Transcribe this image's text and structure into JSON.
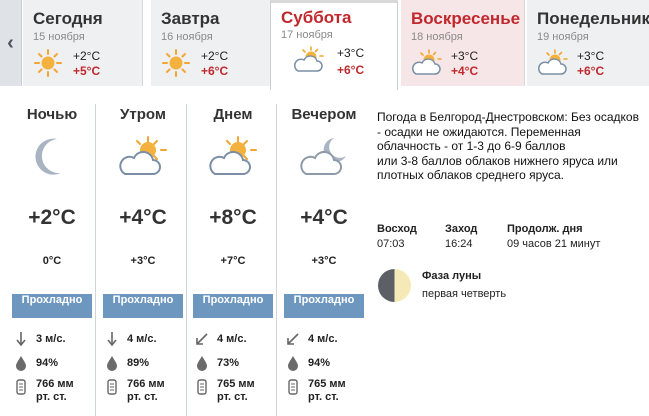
{
  "tabs": [
    {
      "name": "Сегодня",
      "date": "15 ноября",
      "night": "+2°C",
      "day": "+5°C",
      "icon": "sun-icon"
    },
    {
      "name": "Завтра",
      "date": "16 ноября",
      "night": "+2°C",
      "day": "+6°C",
      "icon": "sun-icon"
    },
    {
      "name": "Суббота",
      "date": "17 ноября",
      "night": "+3°C",
      "day": "+6°C",
      "icon": "partly-cloudy-icon"
    },
    {
      "name": "Воскресенье",
      "date": "18 ноября",
      "night": "+3°C",
      "day": "+4°C",
      "icon": "partly-cloudy-icon"
    },
    {
      "name": "Понедельник",
      "date": "19 ноября",
      "night": "+3°C",
      "day": "+6°C",
      "icon": "partly-cloudy-icon"
    }
  ],
  "nav": {
    "prev": "‹"
  },
  "parts": [
    {
      "label": "Ночью",
      "icon": "moon-icon",
      "temp": "+2°C",
      "feels": "0°C",
      "badge": "Прохладно",
      "wind": "3 м/с.",
      "humidity": "94%",
      "pressure_value": "766 мм",
      "pressure_unit": "рт. ст."
    },
    {
      "label": "Утром",
      "icon": "partly-cloudy-icon",
      "temp": "+4°C",
      "feels": "+3°C",
      "badge": "Прохладно",
      "wind": "4 м/с.",
      "humidity": "89%",
      "pressure_value": "766 мм",
      "pressure_unit": "рт. ст."
    },
    {
      "label": "Днем",
      "icon": "partly-cloudy-icon",
      "temp": "+8°C",
      "feels": "+7°C",
      "badge": "Прохладно",
      "wind": "4 м/с.",
      "humidity": "73%",
      "pressure_value": "765 мм",
      "pressure_unit": "рт. ст."
    },
    {
      "label": "Вечером",
      "icon": "cloudy-moon-icon",
      "temp": "+4°C",
      "feels": "+3°C",
      "badge": "Прохладно",
      "wind": "4 м/с.",
      "humidity": "94%",
      "pressure_value": "765 мм",
      "pressure_unit": "рт. ст."
    }
  ],
  "description": "Погода в Белгород-Днестровском: Без осадков - осадки не ожидаются. Переменная облачность - от 1-3 до 6-9 баллов\nили 3-8 баллов облаков нижнего яруса или плотных облаков среднего яруса.",
  "sun": {
    "sunrise_label": "Восход",
    "sunrise": "07:03",
    "sunset_label": "Заход",
    "sunset": "16:24",
    "daylength_label": "Продолж. дня",
    "daylength": "09 часов 21 минут"
  },
  "moon": {
    "title": "Фаза луны",
    "phase": "первая четверть"
  },
  "colors": {
    "accent_red": "#c0282d",
    "badge_blue": "#6e97bf",
    "weekend_bg": "#f7e6e7"
  }
}
